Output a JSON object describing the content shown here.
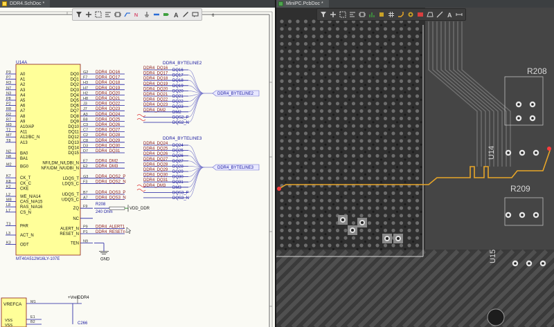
{
  "schematic": {
    "tab_label": "DDR4.SchDoc *",
    "zone_number": "6",
    "part": {
      "designator": "U14A",
      "part_number": "MT40A512M16LY-107E",
      "left_pins": [
        {
          "num": "P3",
          "name": "A0"
        },
        {
          "num": "P7",
          "name": "A1"
        },
        {
          "num": "R3",
          "name": "A2"
        },
        {
          "num": "N7",
          "name": "A3"
        },
        {
          "num": "N3",
          "name": "A4"
        },
        {
          "num": "P8",
          "name": "A5"
        },
        {
          "num": "P2",
          "name": "A6"
        },
        {
          "num": "R8",
          "name": "A7"
        },
        {
          "num": "R2",
          "name": "A8"
        },
        {
          "num": "R7",
          "name": "A9"
        },
        {
          "num": "M3",
          "name": "A10/AP"
        },
        {
          "num": "T2",
          "name": "A11"
        },
        {
          "num": "M7",
          "name": "A12/BC_N"
        },
        {
          "num": "T8",
          "name": "A13"
        },
        {
          "num": "N2",
          "name": "BA0"
        },
        {
          "num": "N8",
          "name": "BA1"
        },
        {
          "num": "M2",
          "name": "BG0"
        },
        {
          "num": "K7",
          "name": "CK_T"
        },
        {
          "num": "K8",
          "name": "CK_C"
        },
        {
          "num": "K2",
          "name": "CKE"
        },
        {
          "num": "L2",
          "name": "WE_N/A14"
        },
        {
          "num": "M8",
          "name": "CAS_N/A15"
        },
        {
          "num": "L8",
          "name": "RAS_N/A16"
        },
        {
          "num": "L7",
          "name": "CS_N"
        },
        {
          "num": "T3",
          "name": "PAR"
        },
        {
          "num": "L3",
          "name": "ACT_N"
        },
        {
          "num": "K3",
          "name": "ODT"
        }
      ],
      "right_pins": [
        {
          "num": "G2",
          "name": "DQ0",
          "net": "DDR4_DQ16"
        },
        {
          "num": "F7",
          "name": "DQ1",
          "net": "DDR4_DQ17"
        },
        {
          "num": "H3",
          "name": "DQ2",
          "net": "DDR4_DQ18"
        },
        {
          "num": "H7",
          "name": "DQ3",
          "net": "DDR4_DQ19"
        },
        {
          "num": "H2",
          "name": "DQ4",
          "net": "DDR4_DQ20"
        },
        {
          "num": "H8",
          "name": "DQ5",
          "net": "DDR4_DQ21"
        },
        {
          "num": "J3",
          "name": "DQ6",
          "net": "DDR4_DQ22"
        },
        {
          "num": "J7",
          "name": "DQ7",
          "net": "DDR4_DQ23"
        },
        {
          "num": "A3",
          "name": "DQ8",
          "net": "DDR4_DQ24"
        },
        {
          "num": "B8",
          "name": "DQ9",
          "net": "DDR4_DQ25"
        },
        {
          "num": "C3",
          "name": "DQ10",
          "net": "DDR4_DQ26"
        },
        {
          "num": "C7",
          "name": "DQ11",
          "net": "DDR4_DQ27"
        },
        {
          "num": "C2",
          "name": "DQ12",
          "net": "DDR4_DQ28"
        },
        {
          "num": "C8",
          "name": "DQ13",
          "net": "DDR4_DQ29"
        },
        {
          "num": "D3",
          "name": "DQ14",
          "net": "DDR4_DQ30"
        },
        {
          "num": "D7",
          "name": "DQ15",
          "net": "DDR4_DQ31"
        },
        {
          "num": "E7",
          "name": "NF/LDM_N/LDBI_N",
          "net": "DDR4_DM2"
        },
        {
          "num": "E2",
          "name": "NF/UDM_N/UDBI_N",
          "net": "DDR4_DM3"
        },
        {
          "num": "G3",
          "name": "LDQS_T",
          "net": "DDR4_DQS2_P"
        },
        {
          "num": "F3",
          "name": "LDQS_C",
          "net": "DDR4_DQS2_N"
        },
        {
          "num": "B7",
          "name": "UDQS_T",
          "net": "DDR4_DQS3_P"
        },
        {
          "num": "A7",
          "name": "UDQS_C",
          "net": "DDR4_DQS3_N"
        },
        {
          "num": "F9",
          "name": "ZQ",
          "net": ""
        },
        {
          "num": "",
          "name": "NC",
          "net": ""
        },
        {
          "num": "P9",
          "name": "ALERT_N",
          "net": "DDR4_ALERT1"
        },
        {
          "num": "P1",
          "name": "RESET_N",
          "net": "DDR4_RESETn"
        },
        {
          "num": "N9",
          "name": "TEN",
          "net": ""
        }
      ]
    },
    "bus1": {
      "title": "DDR4_BYTELINE2",
      "entries": [
        {
          "net": "DDR4_DQ16",
          "pin": "DQ16"
        },
        {
          "net": "DDR4_DQ17",
          "pin": "DQ17"
        },
        {
          "net": "DDR4_DQ18",
          "pin": "DQ18"
        },
        {
          "net": "DDR4_DQ19",
          "pin": "DQ19"
        },
        {
          "net": "DDR4_DQ20",
          "pin": "DQ20"
        },
        {
          "net": "DDR4_DQ21",
          "pin": "DQ21"
        },
        {
          "net": "DDR4_DQ22",
          "pin": "DQ22"
        },
        {
          "net": "DDR4_DQ23",
          "pin": "DQ23"
        },
        {
          "net": "DDR4_DM2",
          "pin": "DM2"
        },
        {
          "net": "",
          "pin": "DQS2_P"
        },
        {
          "net": "",
          "pin": "DQS2_N"
        }
      ],
      "port_label": "DDR4_BYTELINE2"
    },
    "bus2": {
      "title": "DDR4_BYTELINE3",
      "entries": [
        {
          "net": "DDR4_DQ24",
          "pin": "DQ24"
        },
        {
          "net": "DDR4_DQ25",
          "pin": "DQ25"
        },
        {
          "net": "DDR4_DQ26",
          "pin": "DQ26"
        },
        {
          "net": "DDR4_DQ27",
          "pin": "DQ27"
        },
        {
          "net": "DDR4_DQ28",
          "pin": "DQ28"
        },
        {
          "net": "DDR4_DQ29",
          "pin": "DQ29"
        },
        {
          "net": "DDR4_DQ30",
          "pin": "DQ30"
        },
        {
          "net": "DDR4_DQ31",
          "pin": "DQ31"
        },
        {
          "net": "DDR4_DM3",
          "pin": "DM3"
        },
        {
          "net": "",
          "pin": "DQS3_P"
        },
        {
          "net": "",
          "pin": "DQS3_N"
        }
      ],
      "port_label": "DDR4_BYTELINE3"
    },
    "resistor": {
      "designator": "R208",
      "value": "240 Ohm"
    },
    "vdd_label": "VDD_DDR",
    "gnd_label": "GND",
    "vrefca": {
      "box_label": "VREFCA",
      "pin": "M1",
      "net": "+VrefDDR4",
      "vss1": "VSS",
      "vss2": "VSS",
      "pin_e1": "E1",
      "pin_b2": "B2"
    },
    "cap_label": "C266"
  },
  "pcb": {
    "tab_label": "MiniPC.PcbDoc *",
    "labels": {
      "r208": "R208",
      "r209": "R209",
      "u14": "U14",
      "u15": "U15"
    }
  },
  "colors": {
    "net": "#8b1a1a",
    "wire": "#1a1aa0",
    "part_fill": "#ffff99",
    "trace": "#e8a628",
    "selected": "#ff3b3b"
  },
  "icons": {
    "schematic_toolbar": [
      "filter-icon",
      "add-icon",
      "rect-select-icon",
      "align-icon",
      "component-icon",
      "wire-icon",
      "net-label-icon",
      "power-port-icon",
      "bus-icon",
      "port-icon",
      "text-icon",
      "drawing-icon",
      "comment-icon"
    ],
    "pcb_toolbar": [
      "filter-icon",
      "add-icon",
      "rect-select-icon",
      "align-icon",
      "component-icon",
      "chart-icon",
      "pad-icon",
      "grid-icon",
      "route-icon",
      "via-icon",
      "fill-icon",
      "poly-icon",
      "line-icon",
      "text-icon",
      "dimension-icon"
    ]
  }
}
